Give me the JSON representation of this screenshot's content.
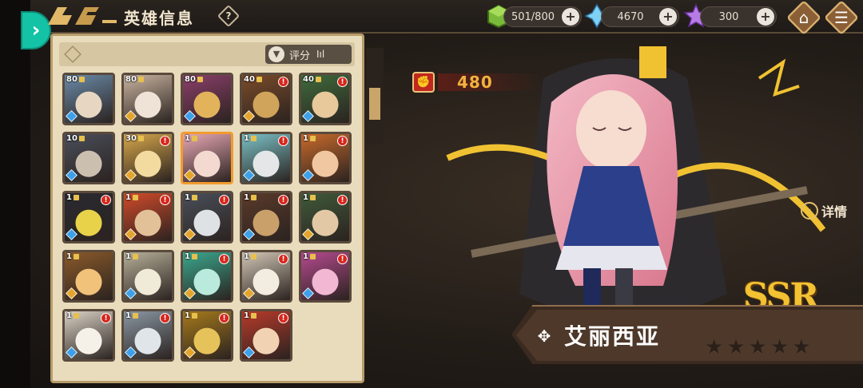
{
  "header": {
    "title": "英雄信息",
    "help_symbol": "?"
  },
  "resources": [
    {
      "name": "energy",
      "value": "501/800",
      "icon": "green-cube-icon",
      "color": "#7ab93a"
    },
    {
      "name": "crystal",
      "value": "4670",
      "icon": "blue-crystal-icon",
      "color": "#7ed1f2"
    },
    {
      "name": "gem",
      "value": "300",
      "icon": "purple-gem-icon",
      "color": "#b77be6"
    }
  ],
  "toolbar": {
    "home_icon": "home-icon",
    "menu_icon": "menu-icon",
    "plus_symbol": "+"
  },
  "roster": {
    "sort_label": "评分",
    "heroes": [
      {
        "level": "80",
        "alert": false,
        "colors": [
          "#6a8aa8",
          "#e7d7c2"
        ],
        "class": "blue"
      },
      {
        "level": "80",
        "alert": false,
        "colors": [
          "#c9b3a0",
          "#efe2d6"
        ],
        "class": "gold"
      },
      {
        "level": "80",
        "alert": false,
        "colors": [
          "#8b3f6a",
          "#e2b35a"
        ],
        "class": "blue"
      },
      {
        "level": "40",
        "alert": true,
        "colors": [
          "#7a4b2a",
          "#d0a45a"
        ],
        "class": "gold"
      },
      {
        "level": "40",
        "alert": true,
        "colors": [
          "#3e6b3c",
          "#e7c99c"
        ],
        "class": "blue"
      },
      {
        "level": "10",
        "alert": false,
        "colors": [
          "#4a4e5a",
          "#cbbfb0"
        ],
        "class": "blue"
      },
      {
        "level": "30",
        "alert": true,
        "colors": [
          "#d7a74b",
          "#f3dba0"
        ],
        "class": "gold"
      },
      {
        "level": "1",
        "alert": false,
        "colors": [
          "#e7a7b3",
          "#f3d9d0"
        ],
        "class": "gold",
        "selected": true
      },
      {
        "level": "1",
        "alert": true,
        "colors": [
          "#7ac0c6",
          "#e4e6e8"
        ],
        "class": "blue"
      },
      {
        "level": "1",
        "alert": true,
        "colors": [
          "#c86a2b",
          "#f0c7a0"
        ],
        "class": "blue"
      },
      {
        "level": "1",
        "alert": true,
        "colors": [
          "#2a2a30",
          "#e8d24a"
        ],
        "class": "blue"
      },
      {
        "level": "1",
        "alert": true,
        "colors": [
          "#d24a2a",
          "#e2c199"
        ],
        "class": "gold"
      },
      {
        "level": "1",
        "alert": true,
        "colors": [
          "#4a4f5a",
          "#dfe2e5"
        ],
        "class": "gold"
      },
      {
        "level": "1",
        "alert": true,
        "colors": [
          "#5a3a2a",
          "#c9a06a"
        ],
        "class": "blue"
      },
      {
        "level": "1",
        "alert": true,
        "colors": [
          "#3f5a3a",
          "#e3c8a5"
        ],
        "class": "gold"
      },
      {
        "level": "1",
        "alert": false,
        "colors": [
          "#8b5a2a",
          "#f0c27a"
        ],
        "class": "gold"
      },
      {
        "level": "1",
        "alert": false,
        "colors": [
          "#b7b099",
          "#f0ead8"
        ],
        "class": "blue"
      },
      {
        "level": "1",
        "alert": true,
        "colors": [
          "#3aa88e",
          "#b9eadc"
        ],
        "class": "gold"
      },
      {
        "level": "1",
        "alert": true,
        "colors": [
          "#d2c7b6",
          "#f3ece0"
        ],
        "class": "gold"
      },
      {
        "level": "1",
        "alert": true,
        "colors": [
          "#b54a8e",
          "#f1b7d3"
        ],
        "class": "blue"
      },
      {
        "level": "1",
        "alert": true,
        "colors": [
          "#d9d2c5",
          "#f6f1e8"
        ],
        "class": "blue"
      },
      {
        "level": "1",
        "alert": true,
        "colors": [
          "#8a97a3",
          "#e0e5ea"
        ],
        "class": "blue"
      },
      {
        "level": "1",
        "alert": true,
        "colors": [
          "#a67a1c",
          "#e6c25a"
        ],
        "class": "gold"
      },
      {
        "level": "1",
        "alert": true,
        "colors": [
          "#b83a2a",
          "#f1d3b3"
        ],
        "class": "blue"
      }
    ]
  },
  "hero": {
    "power": "480",
    "name": "艾丽西亚",
    "rarity": "SSR",
    "detail_label": "详情",
    "stars": 5,
    "stars_lit": 0,
    "accent": "#f0c232"
  }
}
